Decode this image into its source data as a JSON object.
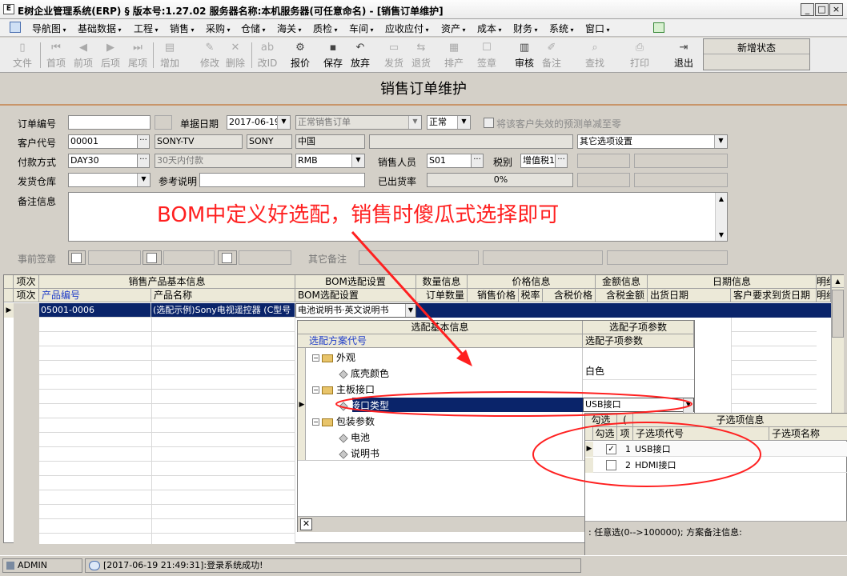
{
  "window": {
    "title": "E树企业管理系统(ERP)  § 版本号:1.27.02   服务器名称:本机服务器(可任意命名) - [销售订单维护]",
    "app_icon": "E"
  },
  "menu": [
    "导航图",
    "基础数据",
    "工程",
    "销售",
    "采购",
    "仓储",
    "海关",
    "质检",
    "车间",
    "应收应付",
    "资产",
    "成本",
    "财务",
    "系统",
    "窗口"
  ],
  "toolbar": {
    "buttons": [
      {
        "label": "文件",
        "icon": "file-icon",
        "enabled": false
      },
      {
        "label": "首项",
        "icon": "first-icon",
        "enabled": false
      },
      {
        "label": "前项",
        "icon": "prev-icon",
        "enabled": false
      },
      {
        "label": "后项",
        "icon": "next-icon",
        "enabled": false
      },
      {
        "label": "尾项",
        "icon": "last-icon",
        "enabled": false
      },
      {
        "label": "增加",
        "icon": "add-icon",
        "enabled": false
      },
      {
        "label": "修改",
        "icon": "edit-icon",
        "enabled": false
      },
      {
        "label": "删除",
        "icon": "delete-icon",
        "enabled": false
      },
      {
        "label": "改ID",
        "icon": "change-id-icon",
        "enabled": false
      },
      {
        "label": "报价",
        "icon": "quote-icon",
        "enabled": true
      },
      {
        "label": "保存",
        "icon": "save-icon",
        "enabled": true
      },
      {
        "label": "放弃",
        "icon": "undo-icon",
        "enabled": true
      },
      {
        "label": "发货",
        "icon": "ship-icon",
        "enabled": false
      },
      {
        "label": "退货",
        "icon": "return-icon",
        "enabled": false
      },
      {
        "label": "排产",
        "icon": "schedule-icon",
        "enabled": false
      },
      {
        "label": "签章",
        "icon": "seal-icon",
        "enabled": false
      },
      {
        "label": "审核",
        "icon": "approve-icon",
        "enabled": true
      },
      {
        "label": "备注",
        "icon": "note-icon",
        "enabled": false
      },
      {
        "label": "查找",
        "icon": "find-icon",
        "enabled": false
      },
      {
        "label": "打印",
        "icon": "print-icon",
        "enabled": false
      },
      {
        "label": "退出",
        "icon": "exit-icon",
        "enabled": true
      }
    ],
    "state_label": "新增状态"
  },
  "form": {
    "heading": "销售订单维护",
    "labels": {
      "order_no": "订单编号",
      "order_date": "单据日期",
      "customer_code": "客户代号",
      "payment": "付款方式",
      "salesperson": "销售人员",
      "tax": "税别",
      "warehouse": "发货仓库",
      "reference": "参考说明",
      "shipped_rate": "已出货率",
      "remarks": "备注信息",
      "pre_sign": "事前签章",
      "other_remarks": "其它备注"
    },
    "order_no": "",
    "order_date": "2017-06-19",
    "order_type": "正常销售订单",
    "status": "正常",
    "cleanup_checkbox": "将该客户失效的预测单减至零",
    "customer_code": "00001",
    "customer_short": "SONY-TV",
    "customer_abbr": "SONY",
    "country": "中国",
    "other_options": "其它选项设置",
    "payment_code": "DAY30",
    "payment_desc": "30天内付款",
    "currency": "RMB",
    "salesperson": "S01",
    "tax": "增值税1",
    "shipped_rate": "0%",
    "reference": "",
    "remarks": ""
  },
  "annotation": "BOM中定义好选配，销售时傻瓜式选择即可",
  "grid": {
    "group_headers": [
      "项次",
      "销售产品基本信息",
      "BOM选配设置",
      "数量信息",
      "价格信息",
      "金额信息",
      "日期信息",
      "明细"
    ],
    "columns": [
      "项次",
      "产品编号",
      "产品名称",
      "BOM选配设置",
      "订单数量",
      "销售价格",
      "税率",
      "含税价格",
      "含税金额",
      "出货日期",
      "客户要求到货日期",
      "明细"
    ],
    "rows": [
      {
        "item": "",
        "product_code": "05001-0006",
        "product_name": "(选配示例)Sony电视遥控器 (C型号",
        "bom": "电池说明书·英文说明书"
      }
    ]
  },
  "config_popup": {
    "header_left": "选配基本信息",
    "header_right": "选配子项参数",
    "col_left": "选配方案代号",
    "col_right": "选配子项参数",
    "tree": [
      {
        "label": "外观",
        "level": 0,
        "kind": "folder",
        "value": ""
      },
      {
        "label": "底壳颜色",
        "level": 1,
        "kind": "leaf",
        "value": "白色"
      },
      {
        "label": "主板接口",
        "level": 0,
        "kind": "folder",
        "value": ""
      },
      {
        "label": "接口类型",
        "level": 1,
        "kind": "leaf",
        "value": "USB接口",
        "selected": true
      },
      {
        "label": "包装参数",
        "level": 0,
        "kind": "folder",
        "value": ""
      },
      {
        "label": "电池",
        "level": 1,
        "kind": "leaf",
        "value": ""
      },
      {
        "label": "说明书",
        "level": 1,
        "kind": "leaf",
        "value": ""
      }
    ]
  },
  "option_popup": {
    "group_left": "勾选",
    "group_left_mark": "(",
    "group_right": "子选项信息",
    "columns": [
      "勾选",
      "项",
      "子选项代号",
      "子选项名称"
    ],
    "rows": [
      {
        "checked": true,
        "no": "1",
        "code": "USB接口",
        "name": ""
      },
      {
        "checked": false,
        "no": "2",
        "code": "HDMI接口",
        "name": ""
      }
    ],
    "footer": ":  任意选(0-->100000); 方案备注信息:"
  },
  "status": {
    "user": "ADMIN",
    "message": "[2017-06-19 21:49:31]:登录系统成功!"
  }
}
